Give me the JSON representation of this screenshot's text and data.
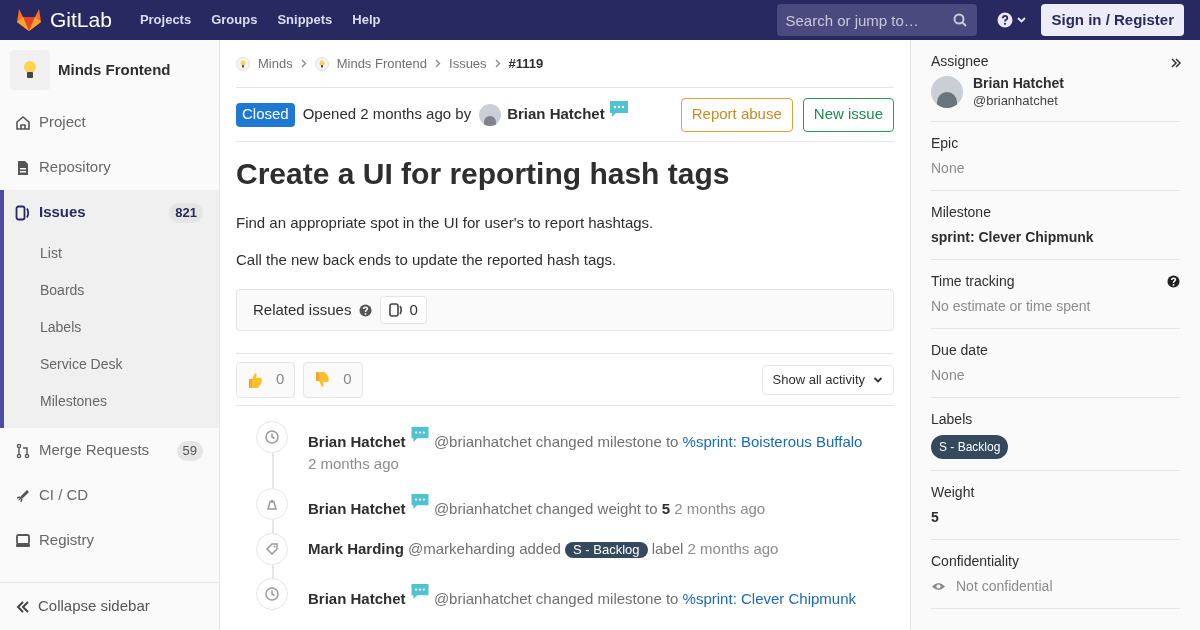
{
  "topbar": {
    "brand": "GitLab",
    "nav": [
      "Projects",
      "Groups",
      "Snippets",
      "Help"
    ],
    "search": {
      "placeholder": "Search or jump to…"
    },
    "sign_in": "Sign in / Register"
  },
  "sidebar": {
    "project": "Minds Frontend",
    "items": [
      {
        "label": "Project",
        "selected": false
      },
      {
        "label": "Repository",
        "selected": false
      },
      {
        "label": "Issues",
        "count": "821",
        "selected": true,
        "children": [
          {
            "label": "List"
          },
          {
            "label": "Boards"
          },
          {
            "label": "Labels"
          },
          {
            "label": "Service Desk"
          },
          {
            "label": "Milestones"
          }
        ]
      },
      {
        "label": "Merge Requests",
        "count": "59",
        "selected": false
      },
      {
        "label": "CI / CD",
        "selected": false
      },
      {
        "label": "Registry",
        "selected": false
      }
    ],
    "collapse": "Collapse sidebar"
  },
  "breadcrumbs": [
    {
      "label": "Minds",
      "logo": true
    },
    {
      "label": "Minds Frontend",
      "logo": true
    },
    {
      "label": "Issues",
      "logo": false
    },
    {
      "label": "#1119",
      "logo": false
    }
  ],
  "issue": {
    "status": "Closed",
    "opened": "Opened 2 months ago by",
    "author": "Brian Hatchet",
    "report_button": "Report abuse",
    "new_button": "New issue",
    "title": "Create a UI for reporting hash tags",
    "description": [
      "Find an appropriate spot in the UI for user's to report hashtags.",
      "Call the new back ends to update the reported hash tags."
    ],
    "related": {
      "label": "Related issues",
      "count": "0"
    },
    "reactions": [
      {
        "kind": "up",
        "count": "0"
      },
      {
        "kind": "down",
        "count": "0"
      }
    ],
    "activity_filter": "Show all activity"
  },
  "timeline": [
    {
      "kind": "milestone",
      "author": "Brian Hatchet",
      "chat_badge": true,
      "action": "@brianhatchet changed milestone to",
      "link": "%sprint: Boisterous Buffalo",
      "time": "2 months ago"
    },
    {
      "kind": "weight",
      "author": "Brian Hatchet",
      "chat_badge": true,
      "action": "@brianhatchet changed weight to **5**",
      "time": "2 months ago"
    },
    {
      "kind": "label",
      "author": "Mark Harding",
      "chat_badge": false,
      "action": "@markeharding added",
      "label": "S - Backlog",
      "suffix": "label",
      "time": "2 months ago"
    },
    {
      "kind": "milestone",
      "author": "Brian Hatchet",
      "chat_badge": true,
      "action": "@brianhatchet changed milestone to",
      "link": "%sprint: Clever Chipmunk"
    }
  ],
  "right_sidebar": {
    "sections": [
      {
        "kind": "user",
        "title": "Assignee",
        "name": "Brian Hatchet",
        "handle": "@brianhatchet"
      },
      {
        "kind": "muted",
        "title": "Epic",
        "value": "None"
      },
      {
        "kind": "bold",
        "title": "Milestone",
        "value": "sprint: Clever Chipmunk"
      },
      {
        "kind": "help",
        "title": "Time tracking",
        "value": "No estimate or time spent"
      },
      {
        "kind": "muted",
        "title": "Due date",
        "value": "None"
      },
      {
        "kind": "label",
        "title": "Labels",
        "value": "S - Backlog"
      },
      {
        "kind": "bold",
        "title": "Weight",
        "value": "5"
      },
      {
        "kind": "eye",
        "title": "Confidentiality",
        "value": "Not confidential"
      }
    ]
  }
}
